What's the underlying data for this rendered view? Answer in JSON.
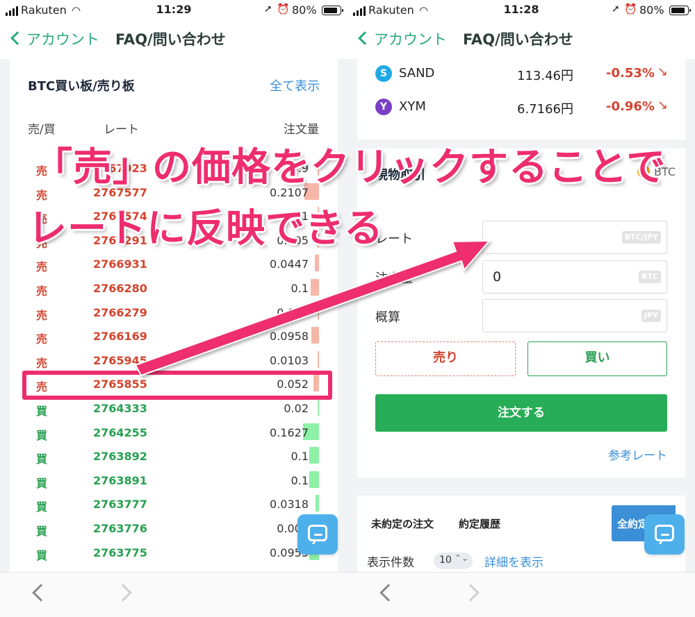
{
  "left": {
    "status": {
      "carrier": "Rakuten",
      "time": "11:29",
      "battery": "80%"
    },
    "nav": {
      "back_label": "アカウント",
      "faq_label": "FAQ/問い合わせ"
    },
    "orderbook": {
      "title": "BTC買い板/売り板",
      "show_all": "全て表示",
      "headers": {
        "side": "売/買",
        "rate": "レート",
        "qty": "注文量"
      },
      "rows": [
        {
          "side": "売",
          "rate": "2767923",
          "qty": "0.9",
          "bar": 0.0
        },
        {
          "side": "売",
          "rate": "2767577",
          "qty": "0.2107",
          "bar": 0.7
        },
        {
          "side": "売",
          "rate": "2767574",
          "qty": "0.1",
          "bar": 0.0
        },
        {
          "side": "売",
          "rate": "2767291",
          "qty": "0.005",
          "bar": 0.05
        },
        {
          "side": "売",
          "rate": "2766931",
          "qty": "0.0447",
          "bar": 0.2
        },
        {
          "side": "売",
          "rate": "2766280",
          "qty": "0.1",
          "bar": 0.4
        },
        {
          "side": "売",
          "rate": "2766279",
          "qty": "0.008",
          "bar": 0.05
        },
        {
          "side": "売",
          "rate": "2766169",
          "qty": "0.0958",
          "bar": 0.35
        },
        {
          "side": "売",
          "rate": "2765945",
          "qty": "0.0103",
          "bar": 0.05
        },
        {
          "side": "売",
          "rate": "2765855",
          "qty": "0.052",
          "bar": 0.25
        },
        {
          "side": "買",
          "rate": "2764333",
          "qty": "0.02",
          "bar": 0.07
        },
        {
          "side": "買",
          "rate": "2764255",
          "qty": "0.1627",
          "bar": 0.75
        },
        {
          "side": "買",
          "rate": "2763892",
          "qty": "0.1",
          "bar": 0.45
        },
        {
          "side": "買",
          "rate": "2763891",
          "qty": "0.1",
          "bar": 0.45
        },
        {
          "side": "買",
          "rate": "2763777",
          "qty": "0.0318",
          "bar": 0.15
        },
        {
          "side": "買",
          "rate": "2763776",
          "qty": "0.005",
          "bar": 0.05
        },
        {
          "side": "買",
          "rate": "2763775",
          "qty": "0.0955",
          "bar": 0.45
        }
      ]
    }
  },
  "right": {
    "status": {
      "carrier": "Rakuten",
      "time": "11:28",
      "battery": "80%"
    },
    "nav": {
      "back_label": "アカウント",
      "faq_label": "FAQ/問い合わせ"
    },
    "coins": [
      {
        "icon": "S",
        "name": "SAND",
        "price": "113.46円",
        "change": "-0.53%",
        "color": "#1fa9e8"
      },
      {
        "icon": "Y",
        "name": "XYM",
        "price": "6.7166円",
        "change": "-0.96%",
        "color": "#7a3fc6"
      }
    ],
    "trade": {
      "title": "現物取引",
      "pair": "BTC",
      "rate_label": "レート",
      "rate_unit": "BTC/JPY",
      "qty_label": "注文量",
      "qty_value": "0",
      "qty_unit": "BTC",
      "approx_label": "概算",
      "approx_unit": "JPY",
      "sell_label": "売り",
      "buy_label": "買い",
      "order_label": "注文する",
      "ref_rate": "参考レート"
    },
    "orders": {
      "tab_open": "未約定の注文",
      "tab_history": "約定履歴",
      "cancel_all": "全約定",
      "count_label": "表示件数",
      "count_value": "10",
      "detail_link": "詳細を表示"
    }
  },
  "annotation": {
    "line1": "「売」の価格をクリックすることで",
    "line2": "レートに反映できる"
  },
  "colors": {
    "accent": "#ee2d6e",
    "sell": "#d4442f",
    "buy": "#27a050",
    "link": "#3a8fd6",
    "primary": "#27ad57"
  }
}
